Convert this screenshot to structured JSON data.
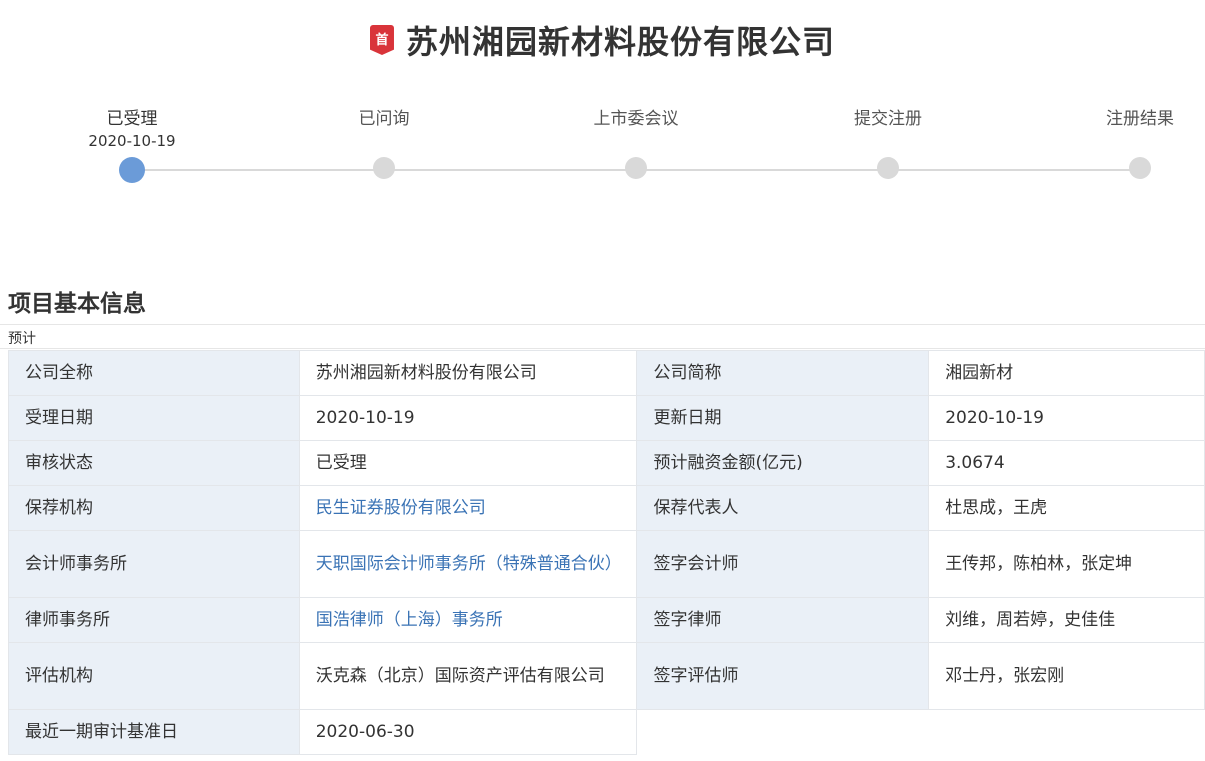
{
  "header": {
    "badge": "首",
    "title": "苏州湘园新材料股份有限公司"
  },
  "progress": {
    "steps": [
      {
        "label": "已受理",
        "date": "2020-10-19",
        "active": true
      },
      {
        "label": "已问询",
        "date": "",
        "active": false
      },
      {
        "label": "上市委会议",
        "date": "",
        "active": false
      },
      {
        "label": "提交注册",
        "date": "",
        "active": false
      },
      {
        "label": "注册结果",
        "date": "",
        "active": false
      }
    ]
  },
  "section": {
    "title": "项目基本信息",
    "note": "预计"
  },
  "info": {
    "rows": [
      {
        "k1": "公司全称",
        "v1": "苏州湘园新材料股份有限公司",
        "k2": "公司简称",
        "v2": "湘园新材"
      },
      {
        "k1": "受理日期",
        "v1": "2020-10-19",
        "k2": "更新日期",
        "v2": "2020-10-19"
      },
      {
        "k1": "审核状态",
        "v1": "已受理",
        "k2": "预计融资金额(亿元)",
        "v2": "3.0674"
      },
      {
        "k1": "保荐机构",
        "v1": "民生证券股份有限公司",
        "k2": "保荐代表人",
        "v2": "杜思成，王虎"
      },
      {
        "k1": "会计师事务所",
        "v1": "天职国际会计师事务所（特殊普通合伙）",
        "k2": "签字会计师",
        "v2": "王传邦，陈柏林，张定坤"
      },
      {
        "k1": "律师事务所",
        "v1": "国浩律师（上海）事务所",
        "k2": "签字律师",
        "v2": "刘维，周若婷，史佳佳"
      },
      {
        "k1": "评估机构",
        "v1": "沃克森（北京）国际资产评估有限公司",
        "k2": "签字评估师",
        "v2": "邓士丹，张宏刚"
      },
      {
        "k1": "最近一期审计基准日",
        "v1": "2020-06-30"
      }
    ]
  },
  "colors": {
    "accent": "#6b9bd8",
    "link": "#3a73b5",
    "badge": "#d9343a",
    "key_bg": "#eaf0f7"
  }
}
